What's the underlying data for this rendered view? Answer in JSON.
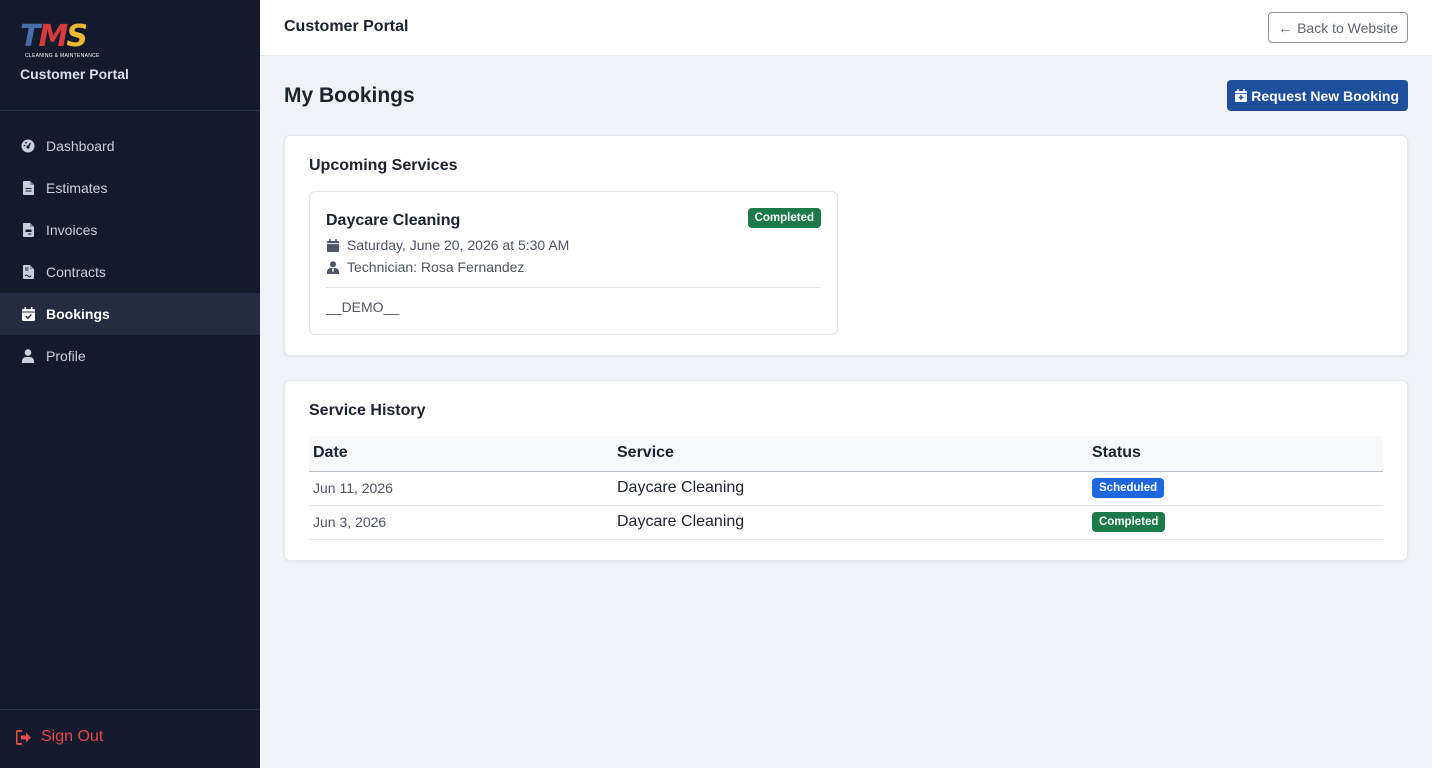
{
  "sidebar": {
    "logo": {
      "letters": [
        "T",
        "M",
        "S"
      ],
      "tagline": "CLEANING & MAINTENANCE"
    },
    "title": "Customer Portal",
    "items": [
      {
        "label": "Dashboard",
        "icon": "dashboard-icon"
      },
      {
        "label": "Estimates",
        "icon": "file-icon"
      },
      {
        "label": "Invoices",
        "icon": "file-invoice-icon"
      },
      {
        "label": "Contracts",
        "icon": "file-contract-icon"
      },
      {
        "label": "Bookings",
        "icon": "calendar-check-icon",
        "active": true
      },
      {
        "label": "Profile",
        "icon": "user-icon"
      }
    ],
    "sign_out": "Sign Out"
  },
  "header": {
    "title": "Customer Portal",
    "back_button": "Back to Website"
  },
  "main": {
    "title": "My Bookings",
    "request_button": "Request New Booking",
    "upcoming": {
      "title": "Upcoming Services",
      "booking": {
        "service": "Daycare Cleaning",
        "status": "Completed",
        "datetime": "Saturday, June 20, 2026 at 5:30 AM",
        "technician": "Technician: Rosa Fernandez",
        "note": "__DEMO__"
      }
    },
    "history": {
      "title": "Service History",
      "columns": [
        "Date",
        "Service",
        "Status"
      ],
      "rows": [
        {
          "date": "Jun 11, 2026",
          "service": "Daycare Cleaning",
          "status": "Scheduled"
        },
        {
          "date": "Jun 3, 2026",
          "service": "Daycare Cleaning",
          "status": "Completed"
        }
      ]
    }
  },
  "colors": {
    "sidebar_bg": "#121a2c",
    "primary": "#1d4f9c",
    "success": "#1c7a48",
    "info": "#1d68e0",
    "danger": "#e5484d"
  }
}
